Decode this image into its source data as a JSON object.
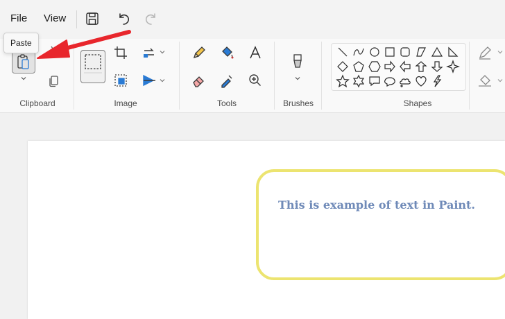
{
  "menu": {
    "file": "File",
    "view": "View"
  },
  "tooltip": "Paste",
  "groups": {
    "clipboard": "Clipboard",
    "image": "Image",
    "tools": "Tools",
    "brushes": "Brushes",
    "shapes": "Shapes"
  },
  "canvas": {
    "text": "This is example of text in Paint."
  },
  "colors": {
    "arrow": "#e8262c",
    "text_border": "#ece470",
    "canvas_text": "#6f8ab8"
  }
}
